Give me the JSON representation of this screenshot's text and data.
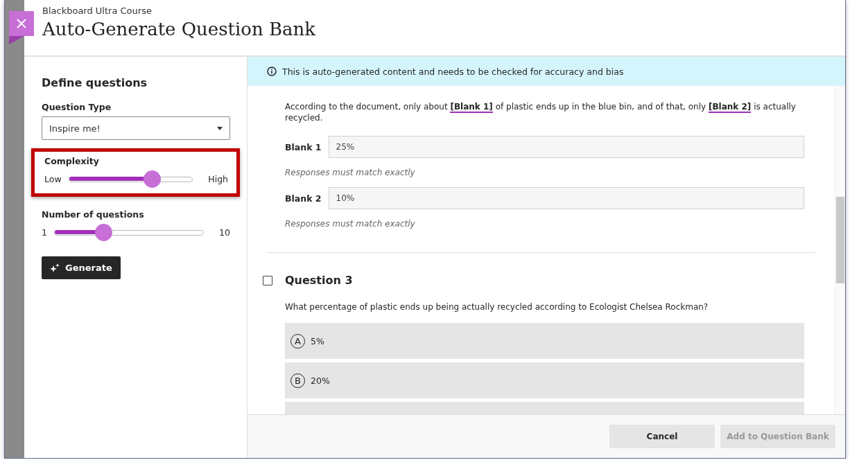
{
  "header": {
    "course": "Blackboard Ultra Course",
    "title": "Auto-Generate Question Bank"
  },
  "sidebar": {
    "heading": "Define questions",
    "question_type": {
      "label": "Question Type",
      "value": "Inspire me!"
    },
    "sliders": [
      {
        "label": "Complexity",
        "min_label": "Low",
        "max_label": "High",
        "level": 0.67,
        "highlighted": true
      },
      {
        "label": "Number of questions",
        "min_label": "1",
        "max_label": "10",
        "level": 0.33,
        "highlighted": false
      }
    ],
    "generate_button": "Generate"
  },
  "notice": "This is auto-generated content and needs to be checked for accuracy and bias",
  "fill_in": {
    "text": "According to the document, only about **[Blank 1]** of plastic ends up in the blue bin, and of that, only **[Blank 2]** is actually recycled.",
    "blanks": [
      {
        "label": "Blank 1",
        "value": "25%",
        "hint": "Responses must match exactly"
      },
      {
        "label": "Blank 2",
        "value": "10%",
        "hint": "Responses must match exactly"
      }
    ]
  },
  "question": {
    "title": "Question 3",
    "checked": false,
    "text": "What percentage of plastic ends up being actually recycled according to Ecologist Chelsea Rockman?",
    "options": [
      {
        "letter": "A",
        "text": "5%"
      },
      {
        "letter": "B",
        "text": "20%"
      }
    ]
  },
  "footer": {
    "buttons": [
      {
        "label": "Cancel",
        "disabled": false
      },
      {
        "label": "Add to Question Bank",
        "disabled": true
      }
    ]
  }
}
